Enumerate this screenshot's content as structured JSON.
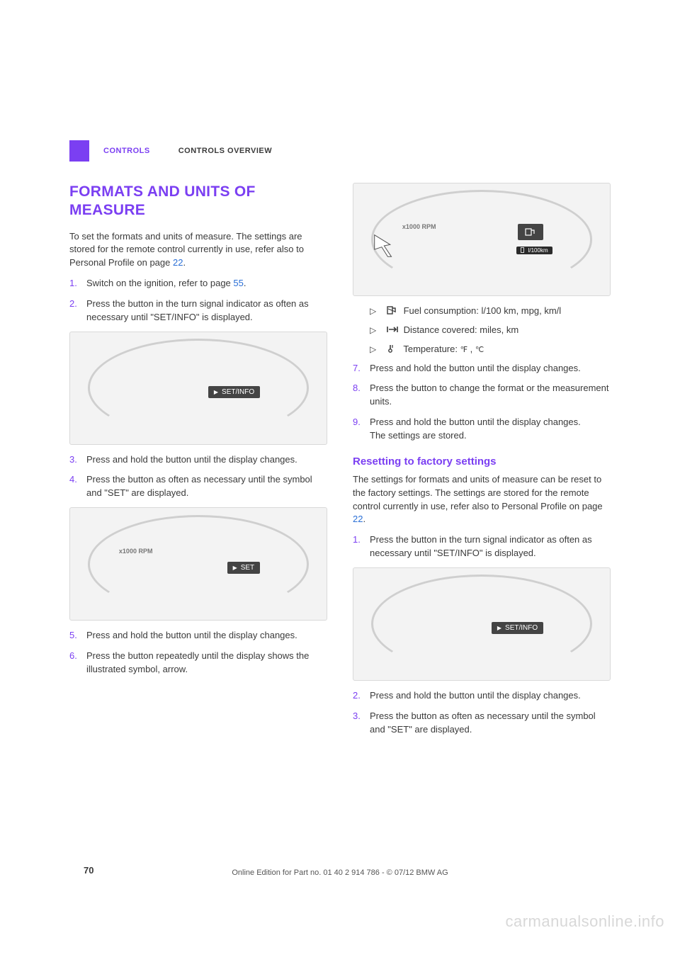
{
  "header": {
    "tab_controls": "CONTROLS",
    "tab_overview": "CONTROLS OVERVIEW"
  },
  "left": {
    "h1": "FORMATS AND UNITS OF MEASURE",
    "intro_a": "To set the formats and units of measure. The set­tings are stored for the remote control currently in use, refer also to Personal Profile on page ",
    "intro_link": "22",
    "intro_b": ".",
    "steps": {
      "s1_a": "Switch on the ignition, refer to page ",
      "s1_link": "55",
      "s1_b": ".",
      "s2": "Press the button in the turn signal indicator as often as necessary until \"SET/INFO\" is displayed.",
      "s3": "Press and hold the button until the display changes.",
      "s4": "Press the button as often as necessary until the symbol and \"SET\" are displayed.",
      "s5": "Press and hold the button until the display changes.",
      "s6": "Press the button repeatedly until the display shows the illustrated symbol, arrow."
    },
    "fig1_label": "SET/INFO",
    "fig2_label": "SET",
    "rpm_label": "x1000\nRPM"
  },
  "right": {
    "fig3_sub": "l/100km",
    "rpm_label": "x1000\nRPM",
    "bullets": {
      "fuel": " Fuel consumption: l/100 km, mpg, km/l",
      "dist": " Distance covered: miles, km",
      "temp_a": " Temperature: ",
      "temp_f": "℉",
      "temp_sep": " , ",
      "temp_c": "℃"
    },
    "s7": "Press and hold the button until the display changes.",
    "s8": "Press the button to change the format or the measurement units.",
    "s9_a": "Press and hold the button until the display changes.",
    "s9_b": "The settings are stored.",
    "h2": "Resetting to factory settings",
    "reset_intro_a": "The settings for formats and units of measure can be reset to the factory settings. The settings are stored for the remote control currently in use, refer also to Personal Profile on page ",
    "reset_intro_link": "22",
    "reset_intro_b": ".",
    "rs1": "Press the button in the turn signal indicator as often as necessary until \"SET/INFO\" is displayed.",
    "fig4_label": "SET/INFO",
    "rs2": "Press and hold the button until the display changes.",
    "rs3": "Press the button as often as necessary until the symbol and \"SET\" are displayed."
  },
  "nums": {
    "n1": "1.",
    "n2": "2.",
    "n3": "3.",
    "n4": "4.",
    "n5": "5.",
    "n6": "6.",
    "n7": "7.",
    "n8": "8.",
    "n9": "9.",
    "r1": "1.",
    "r2": "2.",
    "r3": "3."
  },
  "footer": {
    "page_num": "70",
    "line": "Online Edition for Part no. 01 40 2 914 786 - © 07/12 BMW AG",
    "watermark": "carmanualsonline.info"
  }
}
